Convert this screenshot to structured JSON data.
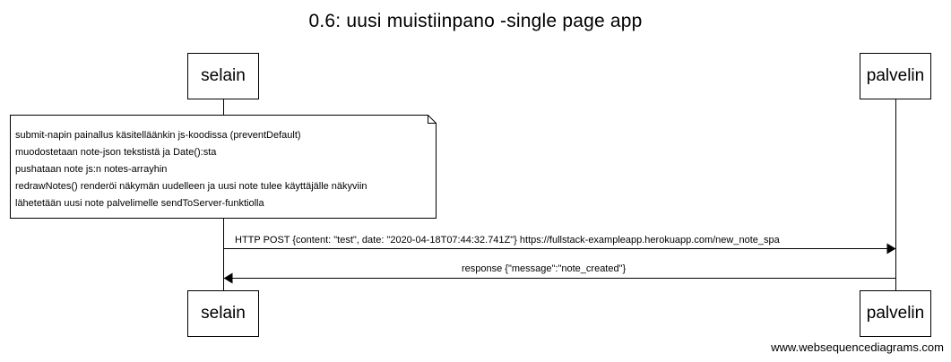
{
  "title": "0.6: uusi muistiinpano -single page app",
  "participants": {
    "left": "selain",
    "right": "palvelin"
  },
  "note": {
    "lines": [
      "submit-napin painallus käsitelläänkin js-koodissa (preventDefault)",
      "muodostetaan note-json tekstistä ja Date():sta",
      "pushataan note js:n notes-arrayhin",
      "redrawNotes() renderöi näkymän uudelleen ja uusi note tulee käyttäjälle näkyviin",
      "lähetetään uusi note palvelimelle sendToServer-funktiolla"
    ]
  },
  "messages": [
    {
      "from": "selain",
      "to": "palvelin",
      "label": "HTTP POST {content: \"test\", date: \"2020-04-18T07:44:32.741Z\"} https://fullstack-exampleapp.herokuapp.com/new_note_spa"
    },
    {
      "from": "palvelin",
      "to": "selain",
      "label": "response {\"message\":\"note_created\"}"
    }
  ],
  "watermark": "www.websequencediagrams.com"
}
